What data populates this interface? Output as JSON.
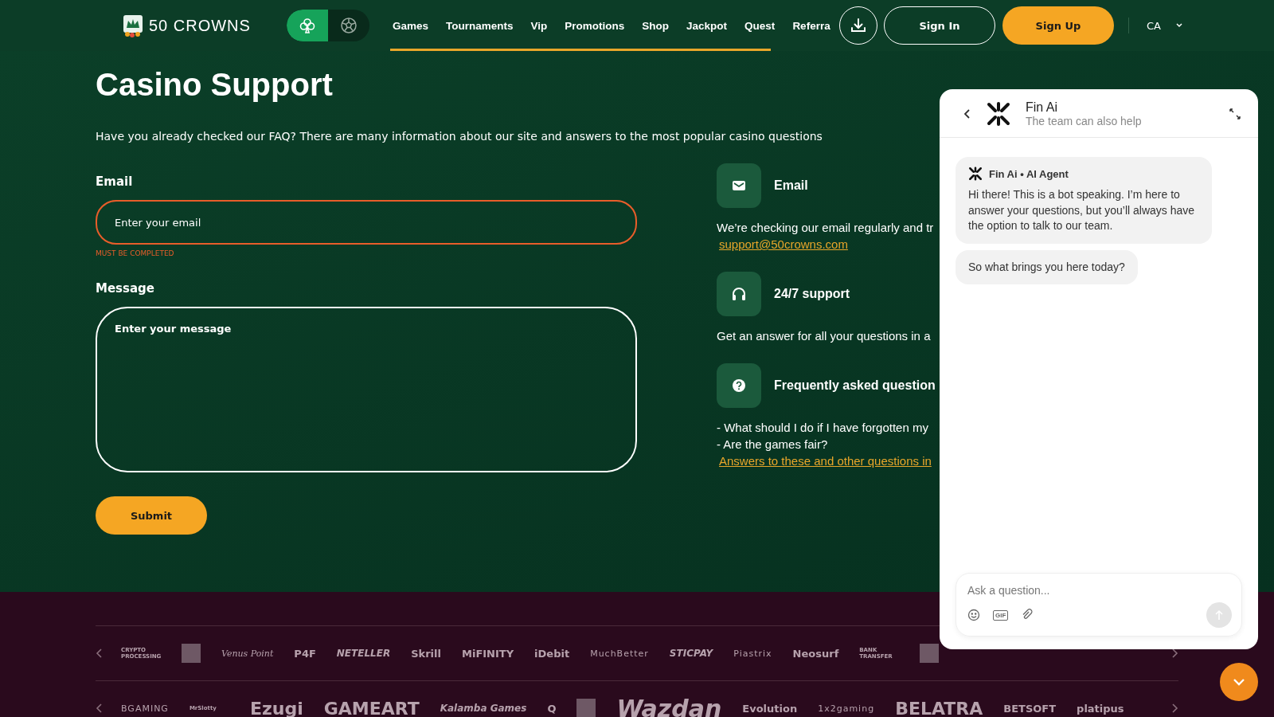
{
  "header": {
    "logo_text": "50 CROWNS",
    "mode_toggle": [
      {
        "kind": "casino",
        "selected": true
      },
      {
        "kind": "sports",
        "selected": false
      }
    ],
    "nav": [
      "Games",
      "Tournaments",
      "Vip",
      "Promotions",
      "Shop",
      "Jackpot",
      "Quest",
      "Referra"
    ],
    "sign_in": "Sign In",
    "sign_up": "Sign Up",
    "language": "CA"
  },
  "page": {
    "title": "Casino Support",
    "intro": "Have you already checked our FAQ? There are many information about our site and answers to the most popular casino questions",
    "form": {
      "fields": [
        {
          "kind": "input",
          "label": "Email",
          "placeholder": "Enter your email",
          "error": "MUST BE COMPLETED"
        },
        {
          "kind": "textarea",
          "label": "Message",
          "placeholder": "Enter your message"
        }
      ],
      "submit": "Submit"
    },
    "contacts": [
      {
        "kind": "email",
        "title": "Email",
        "lines": [
          {
            "kind": "text",
            "text": "We’re checking our email regularly and tr"
          },
          {
            "kind": "link",
            "text": "support@50crowns.com"
          }
        ]
      },
      {
        "kind": "support",
        "title": "24/7 support",
        "lines": [
          {
            "kind": "text",
            "text": "Get an answer for all your questions in a"
          }
        ]
      },
      {
        "kind": "faq",
        "title": "Frequently asked question",
        "lines": [
          {
            "kind": "text",
            "text": "- What should I do if I have forgotten my"
          },
          {
            "kind": "text",
            "text": "- Are the games fair?"
          },
          {
            "kind": "link",
            "text": "Answers to these and other questions in"
          }
        ]
      }
    ]
  },
  "footer": {
    "payment_logos": [
      {
        "kind": "small",
        "text": "CRYPTO PROCESSING"
      },
      {
        "kind": "blank"
      },
      {
        "kind": "script",
        "text": "Venus Point"
      },
      {
        "kind": "bold",
        "text": "P4F"
      },
      {
        "kind": "italic",
        "text": "NETELLER"
      },
      {
        "kind": "bold",
        "text": "Skrill"
      },
      {
        "kind": "bold",
        "text": "MiFINITY"
      },
      {
        "kind": "bold",
        "text": "iDebit"
      },
      {
        "kind": "plain",
        "text": "MuchBetter"
      },
      {
        "kind": "italic",
        "text": "STICPAY"
      },
      {
        "kind": "plain",
        "text": "Piastrix"
      },
      {
        "kind": "bold",
        "text": "Neosurf"
      },
      {
        "kind": "small",
        "text": "BANK TRANSFER"
      },
      {
        "kind": "blank"
      }
    ],
    "provider_logos": [
      {
        "kind": "plain",
        "text": "BGAMING"
      },
      {
        "kind": "small",
        "text": "MrSlotty"
      },
      {
        "kind": "large",
        "text": "Ezugi"
      },
      {
        "kind": "large",
        "text": "GAMEART"
      },
      {
        "kind": "italic",
        "text": "Kalamba Games"
      },
      {
        "kind": "bold",
        "text": "Q"
      },
      {
        "kind": "blank"
      },
      {
        "kind": "huge",
        "text": "Wazdan"
      },
      {
        "kind": "bold",
        "text": "Evolution"
      },
      {
        "kind": "plain",
        "text": "1x2gaming"
      },
      {
        "kind": "large",
        "text": "BELATRA"
      },
      {
        "kind": "bold",
        "text": "BETSOFT"
      },
      {
        "kind": "bold",
        "text": "platipus"
      }
    ]
  },
  "chat": {
    "name": "Fin Ai",
    "subtitle": "The team can also help",
    "messages": [
      {
        "author": "Fin Ai • AI Agent",
        "text": "Hi there! This is a bot speaking. I’m here to answer your questions, but you’ll always have the option to talk to our team."
      },
      {
        "text": "So what brings you here today?"
      }
    ],
    "composer": {
      "placeholder": "Ask a question...",
      "gif_label": "GIF"
    }
  }
}
